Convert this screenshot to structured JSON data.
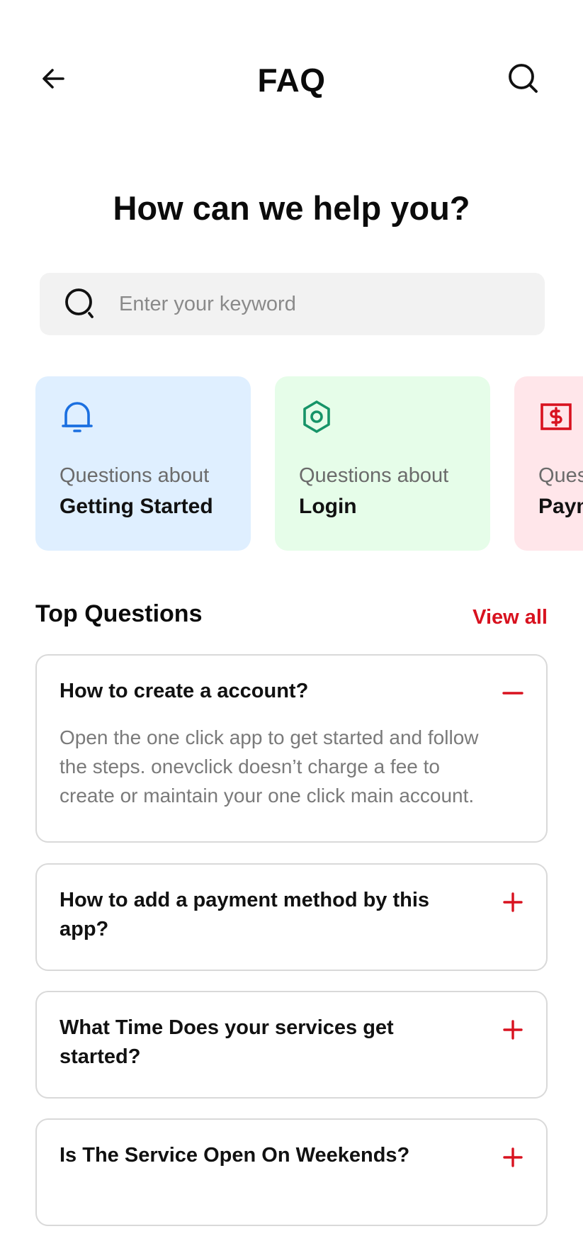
{
  "header": {
    "title": "FAQ",
    "back_icon": "arrow-left-icon",
    "search_icon": "search-icon"
  },
  "hero": {
    "title": "How can we help you?"
  },
  "search": {
    "placeholder": "Enter your keyword",
    "value": ""
  },
  "categories": [
    {
      "prefix": "Questions about",
      "label": "Getting Started",
      "icon": "bell-icon",
      "bg": "#dfefff",
      "accent": "#1a6fe0"
    },
    {
      "prefix": "Questions about",
      "label": "Login",
      "icon": "hexagon-icon",
      "bg": "#e6fde9",
      "accent": "#169468"
    },
    {
      "prefix": "Questions about",
      "label": "Payment",
      "icon": "dollar-bill-icon",
      "bg": "#ffe6ea",
      "accent": "#d8121f"
    }
  ],
  "top_questions": {
    "title": "Top Questions",
    "view_all": "View all",
    "accent": "#d8121f",
    "items": [
      {
        "question": "How to create a account?",
        "answer": "Open the one click app to get started and follow the steps. onevclick  doesn’t charge a fee to create or maintain your one click main account.",
        "expanded": true
      },
      {
        "question": "How to add a payment method by this app?",
        "expanded": false
      },
      {
        "question": "What Time Does your services get started?",
        "expanded": false
      },
      {
        "question": "Is The Service  Open On Weekends?",
        "expanded": false
      }
    ]
  }
}
